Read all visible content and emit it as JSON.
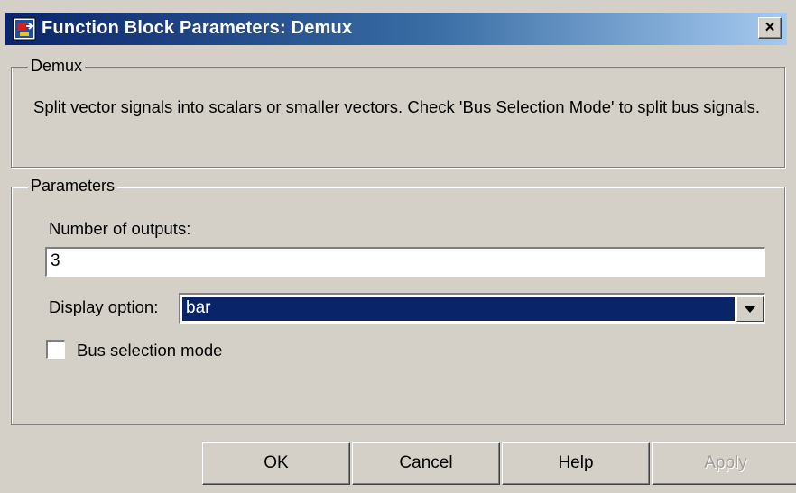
{
  "window": {
    "title": "Function Block Parameters: Demux",
    "close_glyph": "×"
  },
  "demux_group": {
    "legend": "Demux",
    "description": "Split vector signals into scalars or smaller vectors. Check 'Bus Selection Mode' to split bus signals."
  },
  "params_group": {
    "legend": "Parameters",
    "num_outputs_label": "Number of outputs:",
    "num_outputs_value": "3",
    "display_option_label": "Display option:",
    "display_option_value": "bar",
    "bus_selection_label": "Bus selection mode",
    "bus_selection_checked": false
  },
  "buttons": {
    "ok": "OK",
    "cancel": "Cancel",
    "help": "Help",
    "apply": "Apply"
  },
  "colors": {
    "title_gradient_start": "#0a246a",
    "title_gradient_end": "#a6caf0",
    "face": "#d4d0c8",
    "selection": "#0a246a"
  },
  "icons": {
    "app": "simulink-block-icon",
    "close": "close-icon",
    "dropdown": "chevron-down-icon"
  }
}
